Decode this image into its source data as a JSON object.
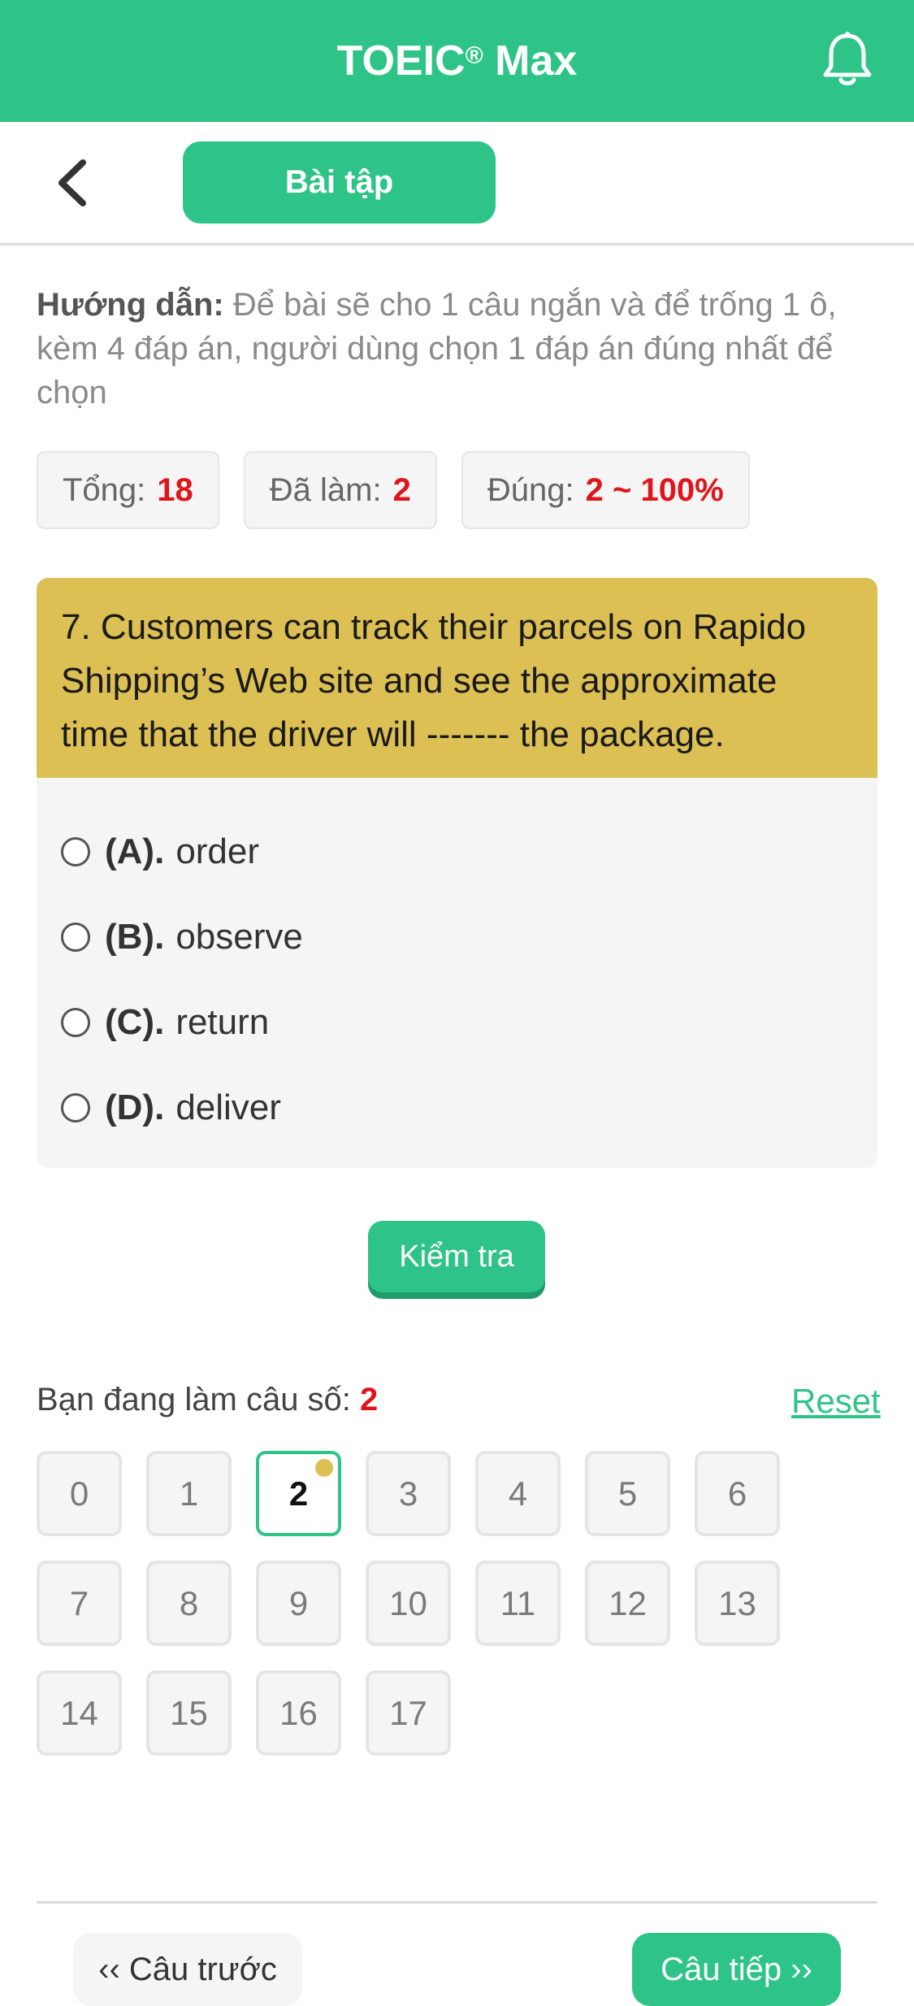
{
  "header": {
    "title": "TOEIC",
    "title_mark": "®",
    "title_suffix": " Max",
    "bell_icon": "bell-icon",
    "color": "#2ec487"
  },
  "subbar": {
    "back_icon": "chevron-left-icon",
    "tab_label": "Bài tập"
  },
  "instructions": {
    "label": "Hướng dẫn:",
    "text": " Để bài sẽ cho 1 câu ngắn và để trống 1 ô, kèm 4 đáp án, người dùng chọn 1 đáp án đúng nhất để chọn"
  },
  "stats": {
    "total_label": "Tổng:",
    "total_value": "18",
    "done_label": "Đã làm:",
    "done_value": "2",
    "correct_label": "Đúng:",
    "correct_value": "2 ~ 100%"
  },
  "question": {
    "text": "7. Customers can track their parcels on Rapido Shipping’s Web site and see the approximate time that the driver will ------- the package.",
    "options": [
      {
        "letter": "(A).",
        "text": "order"
      },
      {
        "letter": "(B).",
        "text": "observe"
      },
      {
        "letter": "(C).",
        "text": "return"
      },
      {
        "letter": "(D).",
        "text": "deliver"
      }
    ]
  },
  "check_button": "Kiểm tra",
  "progress": {
    "label": "Bạn đang làm câu số: ",
    "current": "2",
    "reset": "Reset"
  },
  "grid": [
    "0",
    "1",
    "2",
    "3",
    "4",
    "5",
    "6",
    "7",
    "8",
    "9",
    "10",
    "11",
    "12",
    "13",
    "14",
    "15",
    "16",
    "17"
  ],
  "nav": {
    "prev": "‹‹ Câu trước",
    "next": "Câu tiếp ››"
  }
}
